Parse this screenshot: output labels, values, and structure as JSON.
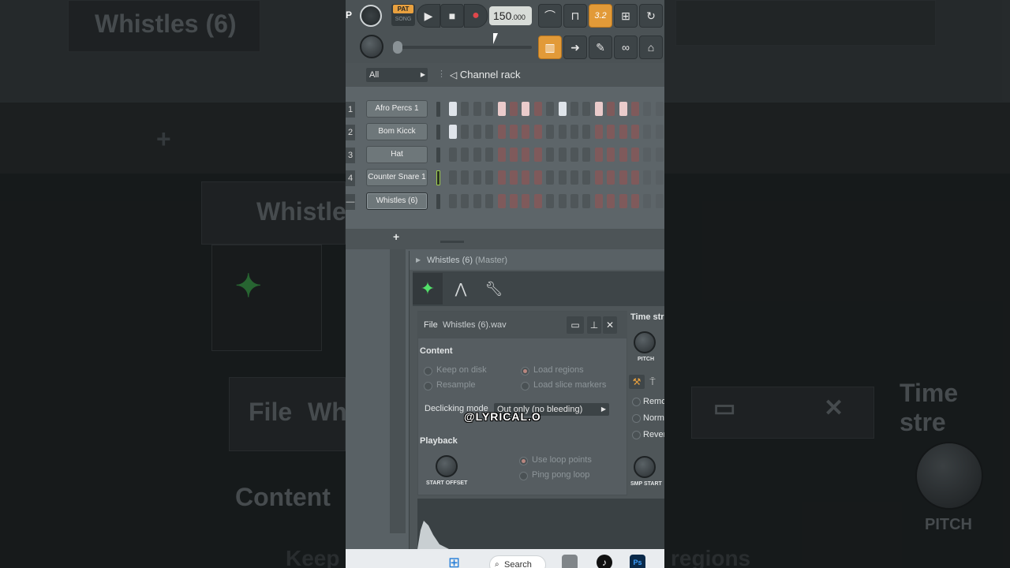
{
  "background": {
    "big_text_1": "Whistles (6)",
    "big_text_2": "Whistles",
    "big_text_3": "File",
    "big_text_4": "Wh",
    "big_text_5": "Content",
    "big_text_6": "Time stre",
    "big_text_7": "PITCH",
    "big_text_8": "Keep",
    "big_text_9": "regions"
  },
  "toolbar": {
    "pat_label": "PAT",
    "song_label": "SONG",
    "tempo_value": "150",
    "tempo_decimal": ".000",
    "pattern_number": "3.2"
  },
  "channel_rack": {
    "filter_label": "All",
    "title": "Channel rack",
    "channels": [
      {
        "num": "1",
        "name": "Afro Percs 1"
      },
      {
        "num": "2",
        "name": "Bom Kicck"
      },
      {
        "num": "3",
        "name": "Hat"
      },
      {
        "num": "4",
        "name": "Counter Snare 1"
      },
      {
        "num": "—",
        "name": "Whistles (6)"
      }
    ],
    "add_label": "+"
  },
  "sampler": {
    "title": "Whistles (6)",
    "title_suffix": "(Master)",
    "file_label": "File",
    "file_name": "Whistles (6).wav",
    "content_header": "Content",
    "keep_on_disk": "Keep on disk",
    "resample": "Resample",
    "load_regions": "Load regions",
    "load_slice_markers": "Load slice markers",
    "declicking_label": "Declicking mode",
    "declicking_value": "Out only (no bleeding)",
    "playback_header": "Playback",
    "start_offset": "START OFFSET",
    "use_loop_points": "Use loop points",
    "ping_pong_loop": "Ping pong loop",
    "time_stretch": "Time stre",
    "pitch_label": "PITCH",
    "remove": "Remo",
    "normalize": "Norm",
    "reverse": "Rever",
    "smp_start": "SMP START"
  },
  "watermark": "@LYRICAL.O",
  "taskbar": {
    "search_label": "Search"
  }
}
